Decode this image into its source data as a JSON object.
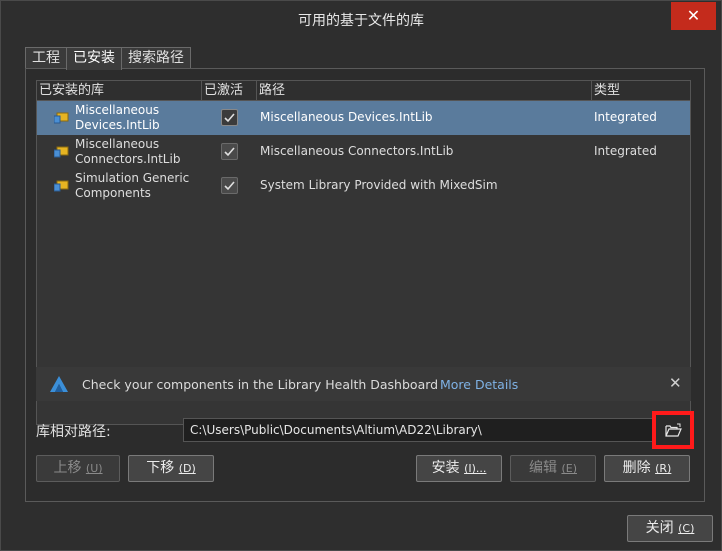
{
  "window": {
    "title": "可用的基于文件的库",
    "close_glyph": "✕"
  },
  "tabs": [
    {
      "label": "工程",
      "active": false
    },
    {
      "label": "已安装",
      "active": true
    },
    {
      "label": "搜索路径",
      "active": false
    }
  ],
  "grid": {
    "columns": [
      "已安装的库",
      "已激活",
      "路径",
      "类型"
    ],
    "rows": [
      {
        "name_line1": "Miscellaneous",
        "name_line2": "Devices.IntLib",
        "active": true,
        "path": "Miscellaneous Devices.IntLib",
        "type": "Integrated",
        "selected": true
      },
      {
        "name_line1": "Miscellaneous",
        "name_line2": "Connectors.IntLib",
        "active": true,
        "path": "Miscellaneous Connectors.IntLib",
        "type": "Integrated",
        "selected": false
      },
      {
        "name_line1": "Simulation Generic",
        "name_line2": "Components",
        "active": true,
        "path": "System Library Provided with MixedSim",
        "type": "",
        "selected": false
      }
    ]
  },
  "banner": {
    "text": "Check your components in the Library Health Dashboard",
    "link": "More Details",
    "close_glyph": "✕",
    "icon": "altium-logo-icon"
  },
  "library_path": {
    "label": "库相对路径:",
    "value": "C:\\Users\\Public\\Documents\\Altium\\AD22\\Library\\",
    "browse_icon": "folder-open-icon"
  },
  "buttons": {
    "move_up": {
      "label": "上移",
      "key": "(U)",
      "enabled": false
    },
    "move_down": {
      "label": "下移",
      "key": "(D)",
      "enabled": true
    },
    "install": {
      "label": "安装",
      "key": "(I)...",
      "enabled": true
    },
    "edit": {
      "label": "编辑",
      "key": "(E)",
      "enabled": false
    },
    "remove": {
      "label": "删除",
      "key": "(R)",
      "enabled": true
    },
    "close": {
      "label": "关闭",
      "key": "(C)",
      "enabled": true
    }
  },
  "colors": {
    "selection": "#5a7b9c",
    "highlight_border": "#ff1a1a",
    "link": "#7fb2e5",
    "title_close": "#c42b1c"
  }
}
